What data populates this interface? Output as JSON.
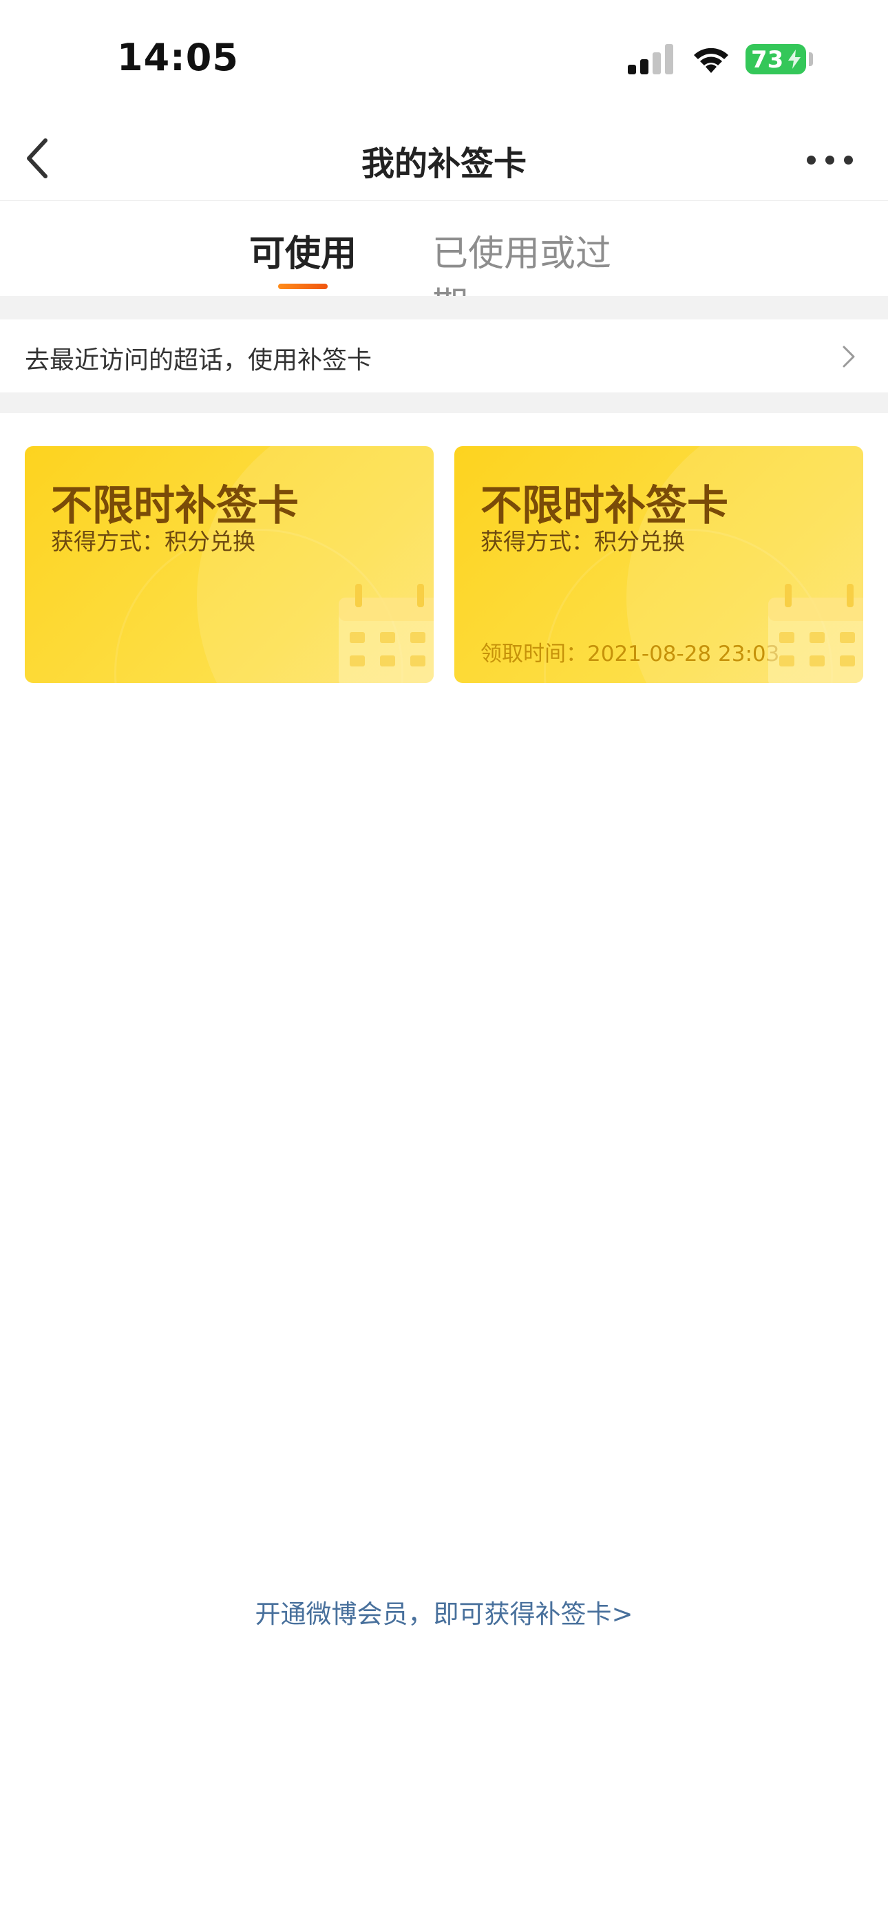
{
  "status_bar": {
    "time": "14:05",
    "battery": "73"
  },
  "nav": {
    "title": "我的补签卡"
  },
  "tabs": [
    {
      "label": "可使用",
      "active": true
    },
    {
      "label": "已使用或过期",
      "active": false
    }
  ],
  "shortcut": {
    "label": "去最近访问的超话，使用补签卡"
  },
  "cards": [
    {
      "title": "不限时补签卡",
      "method": "获得方式：积分兑换",
      "time": ""
    },
    {
      "title": "不限时补签卡",
      "method": "获得方式：积分兑换",
      "time": "领取时间：2021-08-28 23:03"
    }
  ],
  "footer": {
    "vip_link": "开通微博会员，即可获得补签卡>"
  },
  "colors": {
    "accent": "#f0550f",
    "card_yellow": "#fdd31f",
    "link": "#48709c",
    "battery_green": "#34c759"
  }
}
